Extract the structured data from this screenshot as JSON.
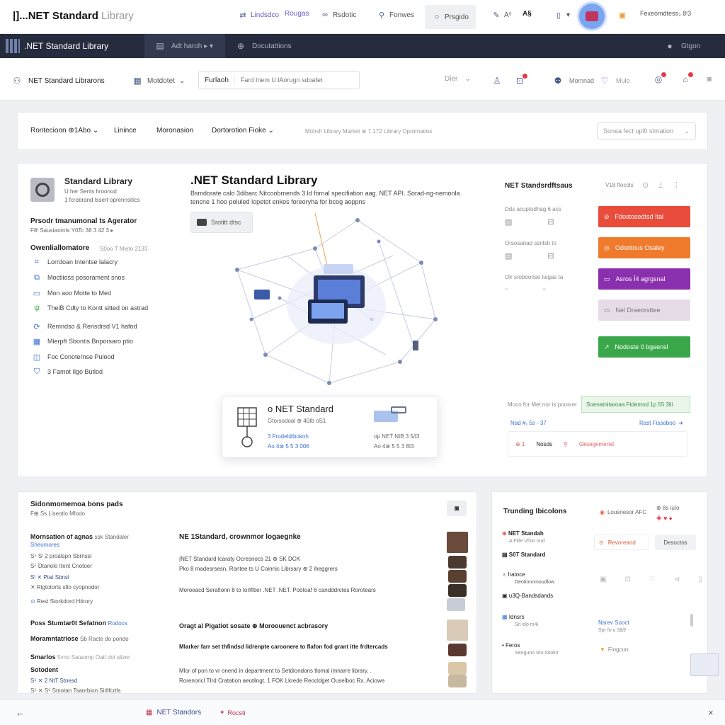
{
  "topbar": {
    "brand": "|]...NET Standard",
    "brand_sub": "Library",
    "items": [
      {
        "icon": "link-icon",
        "label": "Lindsdco"
      },
      {
        "icon": "",
        "label": "Rougas"
      },
      {
        "icon": "binoculars-icon",
        "label": "Rsdotic"
      },
      {
        "icon": "person-icon",
        "label": "Fonwes"
      },
      {
        "icon": "search-icon",
        "label": "Prsgido"
      },
      {
        "icon": "translate-icon",
        "label": "A⁵"
      },
      {
        "icon": "text-icon",
        "label": "A§"
      },
      {
        "icon": "document-icon",
        "label": "▾"
      }
    ],
    "right_label": "Fexeomdtess₃ 8ᵗ3"
  },
  "darknav": {
    "title": ".NET Standard Library",
    "tabs": [
      "Adt haroh ▸ ▾",
      "Docutattions"
    ],
    "right": "Gtgon"
  },
  "toolbar": {
    "left_item": "NET Standard Librarons",
    "dropdown": "Motdotet",
    "search_label": "Furlaoh",
    "search_placeholder": "Fard Inem U lAorugn sdoafet",
    "filter_label": "Dier",
    "right_items": [
      "Momnad",
      "Mulo"
    ]
  },
  "filterbar": {
    "items": [
      "Rontecioon ⊕1Abo",
      "Linince",
      "Moronasion",
      "Dortorotion Fioke"
    ],
    "summary": "Mohsh Library Market ⊕ 7.172 Library Oprornatios",
    "select": "Sonea fect upl0 stmation"
  },
  "library": {
    "name": "Standard Library",
    "line1": "U her Sents hroonod",
    "line2": "1 fcrobrand lssert oprennsitics",
    "subtitle": "Prsodr tmanumonal ts Agerator",
    "sub_meta": "F8ᵗ  Saustaomts  Y0Tc 38  3 42 3 ▸",
    "section": "Owenliallomatore",
    "section_meta": "S0oo T Mieto 2133",
    "rows": [
      {
        "icon": "code-icon",
        "label": "Lorrdoan Intentse lalacry"
      },
      {
        "icon": "package-icon",
        "label": "Moctlioss posorament snos"
      },
      {
        "icon": "monitor-icon",
        "label": "Mon aoo Motte to Med"
      },
      {
        "icon": "plug-icon",
        "label": "ThelB Cdty to Kontt sitted on astrad"
      },
      {
        "icon": "refresh-icon",
        "label": "Remndso & Rensdrsd V1 hafod"
      },
      {
        "icon": "grid-icon",
        "label": "Mierpft Sbontis Bnporsaro ptio"
      },
      {
        "icon": "layers-icon",
        "label": "Foc Conoternse Pulood"
      },
      {
        "icon": "shield-icon",
        "label": "3 Famot Ilgo Butlod"
      }
    ]
  },
  "hero": {
    "title": ".NET Standard Library",
    "description": "Bsmdorate calo 3dibarc Nitcoobmends 3.ld fornal specifiation aag. NET API. Sorad-ng-nemonla tencne 1 hoo poluled lopetot enkos foreoryha for bcog aoppns",
    "button": "Srotitt dtsc"
  },
  "info_card": {
    "title": "o NET Standard",
    "meta": "Gtorsodoal  ⊕  40Ib  oS1",
    "left_line1": "3 Frodeldtbokoh",
    "left_line2": "Ao 4⊗ 5 5 3 006",
    "right_line1": "op NET NIB 3 5∂3",
    "right_line2": "Ao 4⊗ 5 5 3 8I3"
  },
  "right_panel": {
    "title": "NET Standsrdftsaus",
    "title_meta": "V18 ftocols",
    "rows": [
      "Dds acuptodhag 6 acs",
      "Orsosanad ssnlsh to",
      "Olr sroboonse luigas ta"
    ],
    "buttons": [
      {
        "label": "Fdostosedtsd Ital",
        "color": "#ea4c3c"
      },
      {
        "label": "Odoritous Osaley",
        "color": "#f07a2c"
      },
      {
        "label": "Asros Î4 agrgsnal",
        "color": "#8a2fae"
      },
      {
        "label": "Nel Draeorsttee",
        "color": "#e6dce8"
      },
      {
        "label": "Nodoste 0 bgeensl",
        "color": "#3aa84a"
      }
    ],
    "status_left": "Moco for Met nor is poosrer",
    "status_right": "Soenatnitaroaa Ftdemod 1p 55 3lii",
    "link_left": "Nad #₁ 5s - 37",
    "link_right": "Rast Fissoboo",
    "chip_mid": "Nosds",
    "chip_right": "Gksegemenst"
  },
  "bottom_left": {
    "title": "Sidonmomemoa bons pads",
    "subtitle": "F⊞ Ss Liseotlo Mlodo",
    "col1": [
      {
        "text": "Mornsation of agnas",
        "meta": "ssk Standaler"
      },
      {
        "text": "Sheumores",
        "meta": ""
      },
      {
        "text": "S⁵ Sᵗ 2 proalspn Sbrnssl",
        "meta": ""
      },
      {
        "text": "S⁵ Dtanolo Itent Cnotoer",
        "meta": ""
      },
      {
        "text": "Sᵗ ✕ Ptat Sbnsl",
        "meta": ""
      },
      {
        "text": "✕ Rigtotorts sfio cyopnodor",
        "meta": ""
      },
      {
        "text": "Rest Storkdord Hitrory",
        "meta": ""
      }
    ],
    "col1b": [
      {
        "text": "Poss Stumtar0t Sefatnon",
        "meta": "Rodocs"
      },
      {
        "text": "Moramntatriose",
        "meta": "Sb Racte do pondo"
      },
      {
        "text": "Smarlos",
        "meta": "5vno Sataomp Oatl dot slizer"
      },
      {
        "text": "Sotodent",
        "meta": ""
      },
      {
        "text": "S⁵ ✕ 2 NtT Stnesd",
        "meta": ""
      },
      {
        "text": "S⁵ ✕ S⁵ Smotan Tsanrbion Sirllfcrtls",
        "meta": ""
      }
    ],
    "article1_title": "NE 1Standard, crownmor logaegnke",
    "article1_l1": "|NET Standard lcaraty Ocresnocs 21  ⊕ SK DCK",
    "article1_l2": "Pko 8 madesrsesn, Rontee ts U Coinnic Librsary ⊕ 2 iheggrers",
    "article1_l3": "Moroeacd Serafionn 8 to torlfitier .NET .NET. Pootoaf 6 candddrctes Rorotears",
    "article2_title": "Oragt al Pigatiot sosate ⊕ Moroouenct acbrasory",
    "article2_l1": "Mlarker farr set thfindsd lidrenpte caroonere to flafon fod grant itte frdtercads",
    "article2_l2": "Mlor of pon to vr onend in department to Setdiondons tlomal imnarre library. .",
    "article2_l3": "Rorenoricl TIrd Cratation aeutilngt, 1 FOK Lkrede Reocldget Ouselboc Rx. Aciowe"
  },
  "bottom_right": {
    "title": "Trunding Ibicolons",
    "meta1": "Lousnesor AFC",
    "meta2": "⊕ 8s iuîo",
    "btn1": "Revoreand",
    "btn2": "Desoctos",
    "items": [
      {
        "t": "NET Standah",
        "s": "A Fitle Vhiio oud"
      },
      {
        "t": "S0T Standard",
        "s": ""
      },
      {
        "t": "Iratoce",
        "s": "Deotionnmoudlow"
      },
      {
        "t": "ʊ3Q-Bandsdands",
        "s": ""
      },
      {
        "t": "Idnsrs",
        "s": "Sn elo m4i"
      },
      {
        "t": "Feros",
        "s": "Seoguno Sto totolnr"
      }
    ],
    "right_a": "Nsrev Sooct",
    "right_a_meta": "Spr fo u 3&9",
    "right_b": "Fiogcun"
  },
  "bottombar": {
    "tab1": "NET Standors",
    "tab2": "Rocsti"
  }
}
